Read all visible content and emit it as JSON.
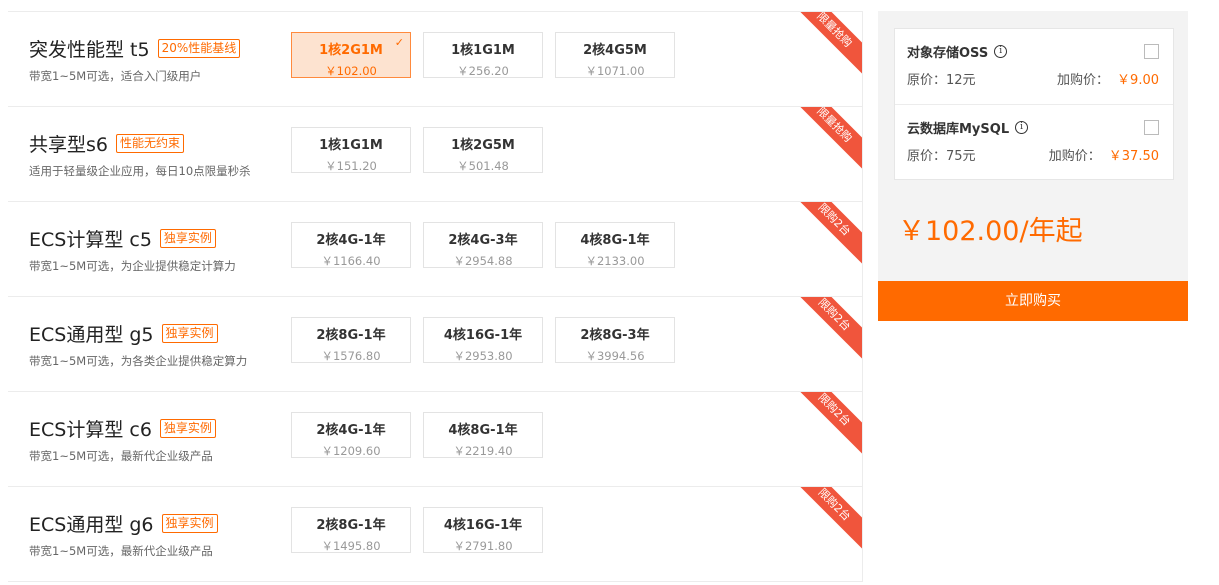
{
  "products": [
    {
      "name": "突发性能型 t5",
      "tag": "20%性能基线",
      "desc": "带宽1~5M可选，适合入门级用户",
      "ribbon": "限量抢购",
      "options": [
        {
          "spec": "1核2G1M",
          "price": "￥102.00",
          "selected": true
        },
        {
          "spec": "1核1G1M",
          "price": "￥256.20"
        },
        {
          "spec": "2核4G5M",
          "price": "￥1071.00"
        }
      ]
    },
    {
      "name": "共享型s6",
      "tag": "性能无约束",
      "desc": "适用于轻量级企业应用，每日10点限量秒杀",
      "ribbon": "限量抢购",
      "options": [
        {
          "spec": "1核1G1M",
          "price": "￥151.20"
        },
        {
          "spec": "1核2G5M",
          "price": "￥501.48"
        }
      ]
    },
    {
      "name": "ECS计算型 c5",
      "tag": "独享实例",
      "desc": "带宽1~5M可选，为企业提供稳定计算力",
      "ribbon": "限购2台",
      "options": [
        {
          "spec": "2核4G-1年",
          "price": "￥1166.40"
        },
        {
          "spec": "2核4G-3年",
          "price": "￥2954.88"
        },
        {
          "spec": "4核8G-1年",
          "price": "￥2133.00"
        }
      ]
    },
    {
      "name": "ECS通用型 g5",
      "tag": "独享实例",
      "desc": "带宽1~5M可选，为各类企业提供稳定算力",
      "ribbon": "限购2台",
      "options": [
        {
          "spec": "2核8G-1年",
          "price": "￥1576.80"
        },
        {
          "spec": "4核16G-1年",
          "price": "￥2953.80"
        },
        {
          "spec": "2核8G-3年",
          "price": "￥3994.56"
        }
      ]
    },
    {
      "name": "ECS计算型 c6",
      "tag": "独享实例",
      "desc": "带宽1~5M可选，最新代企业级产品",
      "ribbon": "限购2台",
      "options": [
        {
          "spec": "2核4G-1年",
          "price": "￥1209.60"
        },
        {
          "spec": "4核8G-1年",
          "price": "￥2219.40"
        }
      ]
    },
    {
      "name": "ECS通用型 g6",
      "tag": "独享实例",
      "desc": "带宽1~5M可选，最新代企业级产品",
      "ribbon": "限购2台",
      "options": [
        {
          "spec": "2核8G-1年",
          "price": "￥1495.80"
        },
        {
          "spec": "4核16G-1年",
          "price": "￥2791.80"
        }
      ]
    }
  ],
  "addons": [
    {
      "name": "对象存储OSS",
      "orig_label": "原价：",
      "orig": "12元",
      "buy_label": "加购价：",
      "buy": "￥9.00"
    },
    {
      "name": "云数据库MySQL",
      "orig_label": "原价：",
      "orig": "75元",
      "buy_label": "加购价：",
      "buy": "￥37.50"
    }
  ],
  "total": "￥102.00/年起",
  "buy_button": "立即购买",
  "check_icon": "✓",
  "info_icon": "i",
  "colors": {
    "accent": "#ff6a00",
    "ribbon": "#f0553c"
  }
}
